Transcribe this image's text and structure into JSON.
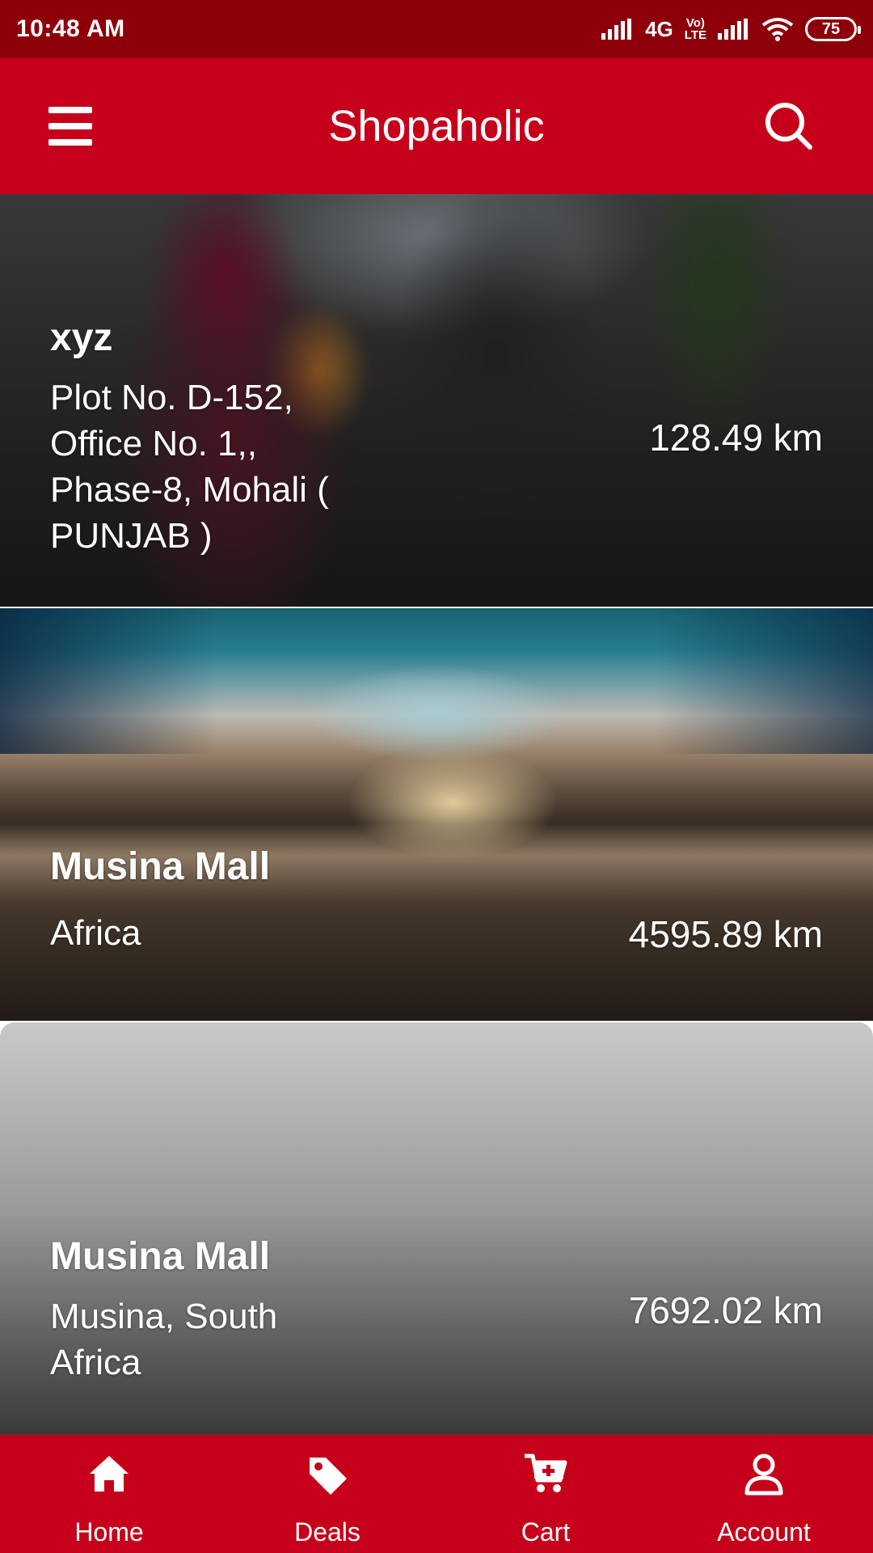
{
  "status_bar": {
    "time": "10:48 AM",
    "network": "4G",
    "volte_top": "Vo)",
    "volte_bottom": "LTE",
    "battery": "75"
  },
  "app_bar": {
    "title": "Shopaholic"
  },
  "stores": [
    {
      "name": "xyz",
      "address": "Plot No. D-152, Office No. 1,, Phase-8, Mohali ( PUNJAB )",
      "distance": "128.49 km"
    },
    {
      "name": "Musina Mall",
      "address": "Africa",
      "distance": "4595.89 km"
    },
    {
      "name": "Musina Mall",
      "address": "Musina, South Africa",
      "distance": "7692.02 km"
    }
  ],
  "bottom_nav": [
    {
      "label": "Home",
      "icon": "home-icon"
    },
    {
      "label": "Deals",
      "icon": "tag-icon"
    },
    {
      "label": "Cart",
      "icon": "cart-icon"
    },
    {
      "label": "Account",
      "icon": "user-icon"
    }
  ],
  "colors": {
    "primary": "#c6001b",
    "status_bar": "#8e0009"
  }
}
